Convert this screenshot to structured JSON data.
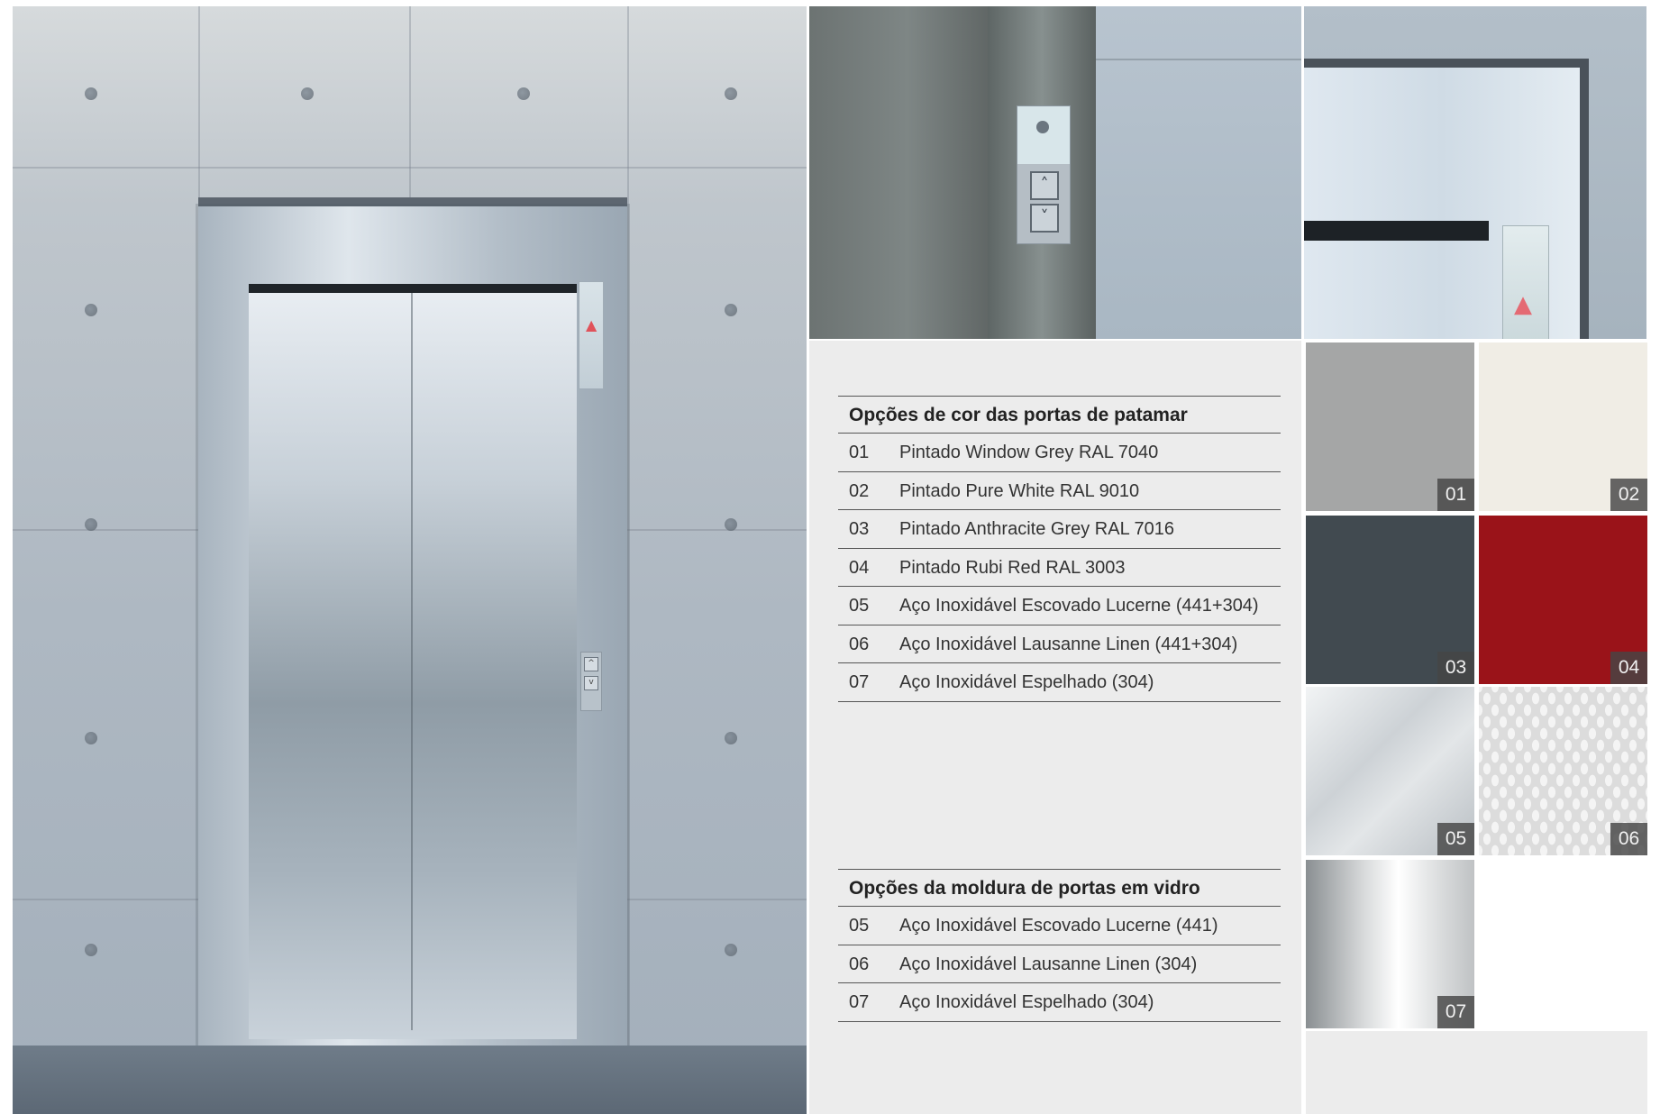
{
  "landing_door_colors": {
    "title": "Opções de cor das portas de patamar",
    "rows": [
      {
        "num": "01",
        "label": "Pintado Window Grey RAL 7040"
      },
      {
        "num": "02",
        "label": "Pintado Pure White RAL 9010"
      },
      {
        "num": "03",
        "label": "Pintado Anthracite Grey RAL 7016"
      },
      {
        "num": "04",
        "label": "Pintado Rubi Red RAL 3003"
      },
      {
        "num": "05",
        "label": "Aço Inoxidável Escovado Lucerne (441+304)"
      },
      {
        "num": "06",
        "label": "Aço Inoxidável Lausanne Linen (441+304)"
      },
      {
        "num": "07",
        "label": "Aço Inoxidável Espelhado (304)"
      }
    ]
  },
  "glass_door_frame": {
    "title": "Opções da moldura de portas em vidro",
    "rows": [
      {
        "num": "05",
        "label": "Aço Inoxidável Escovado Lucerne (441)"
      },
      {
        "num": "06",
        "label": "Aço Inoxidável Lausanne Linen (304)"
      },
      {
        "num": "07",
        "label": "Aço Inoxidável Espelhado (304)"
      }
    ]
  },
  "swatches": [
    {
      "num": "01",
      "color": "#a5a6a6"
    },
    {
      "num": "02",
      "color": "#f0ede5"
    },
    {
      "num": "03",
      "color": "#414a50"
    },
    {
      "num": "04",
      "color": "#9a1319"
    },
    {
      "num": "05",
      "color": "#cdd2d6"
    },
    {
      "num": "06",
      "color": "#dcdcdc"
    },
    {
      "num": "07",
      "color": "#e0e2e3"
    }
  ]
}
